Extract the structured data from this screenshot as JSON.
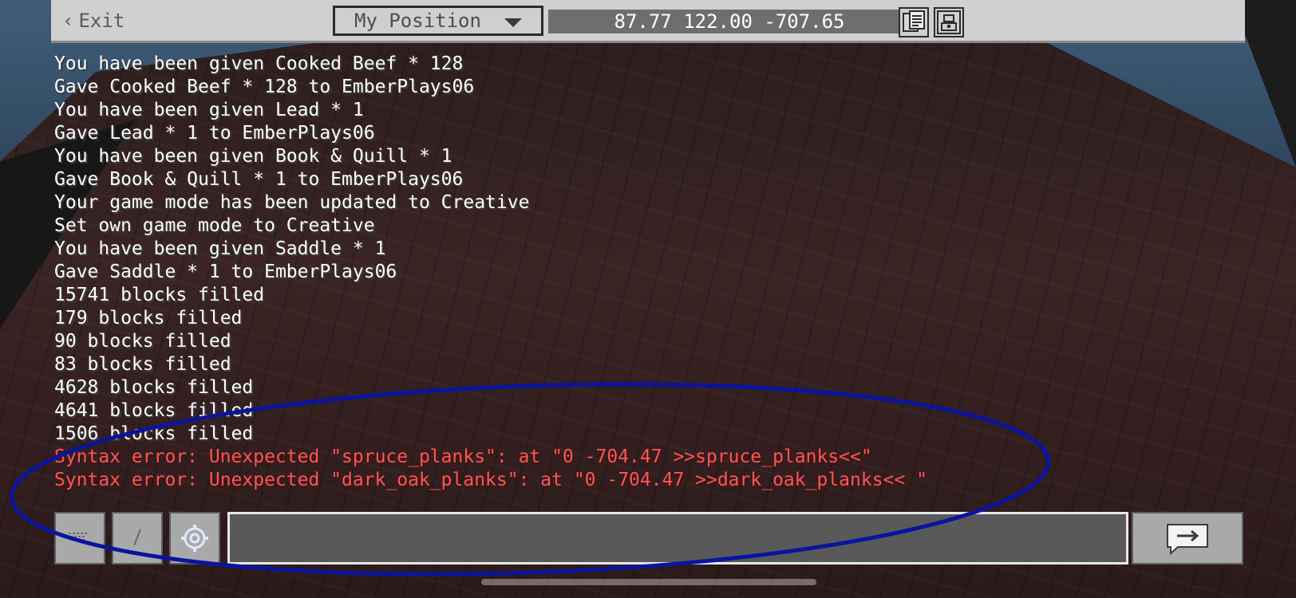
{
  "topbar": {
    "exit_label": "Exit",
    "exit_chevron": "‹",
    "position_select": "My Position",
    "coordinates": "87.77 122.00 -707.65",
    "icons": [
      "copy-coordinates-icon",
      "screenshot-icon"
    ]
  },
  "chat": {
    "lines": [
      "You have been given Cooked Beef * 128",
      "Gave Cooked Beef * 128 to EmberPlays06",
      "You have been given Lead * 1",
      "Gave Lead * 1 to EmberPlays06",
      "You have been given Book & Quill * 1",
      "Gave Book & Quill * 1 to EmberPlays06",
      "Your game mode has been updated to Creative",
      "Set own game mode to Creative",
      "You have been given Saddle * 1",
      "Gave Saddle * 1 to EmberPlays06",
      "15741 blocks filled",
      "179 blocks filled",
      "90 blocks filled",
      "83 blocks filled",
      "4628 blocks filled",
      "4641 blocks filled",
      "1506 blocks filled"
    ],
    "errors": [
      "Syntax error: Unexpected \"spruce_planks\": at \"0 -704.47 >>spruce_planks<<\"",
      "Syntax error: Unexpected \"dark_oak_planks\": at \"0 -704.47 >>dark_oak_planks<< \""
    ],
    "input_value": "",
    "colors": {
      "normal": "#ffffff",
      "error": "#ff5555"
    }
  },
  "controls": {
    "buttons": [
      "keyboard-icon",
      "slash-command-icon",
      "settings-gear-icon",
      "send-arrow-icon"
    ]
  },
  "annotation": {
    "shape": "ellipse",
    "color": "#0a14a0"
  }
}
